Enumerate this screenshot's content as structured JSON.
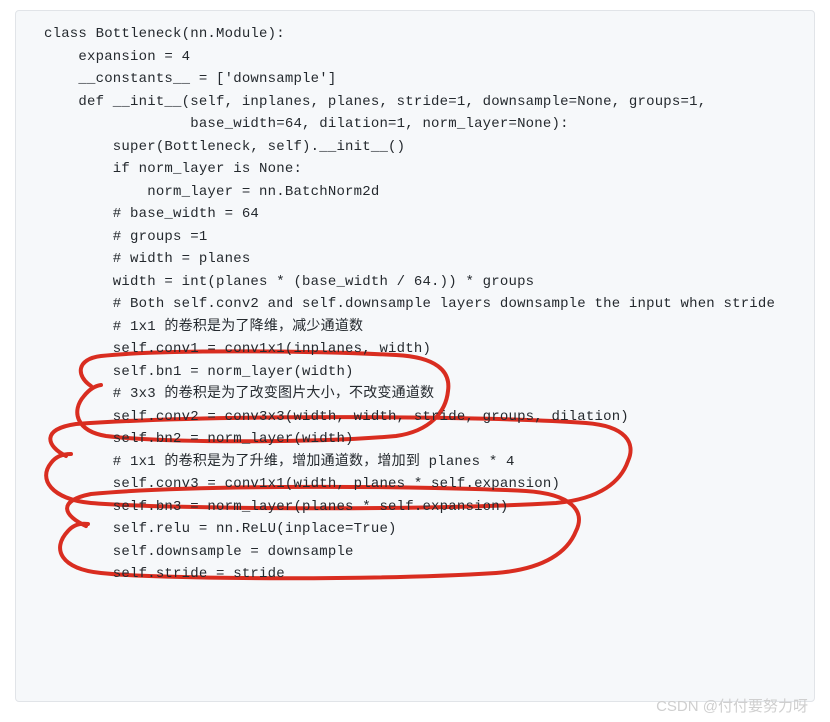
{
  "code": {
    "lines": [
      "class Bottleneck(nn.Module):",
      "    expansion = 4",
      "    __constants__ = ['downsample']",
      "",
      "    def __init__(self, inplanes, planes, stride=1, downsample=None, groups=1,",
      "                 base_width=64, dilation=1, norm_layer=None):",
      "        super(Bottleneck, self).__init__()",
      "        if norm_layer is None:",
      "            norm_layer = nn.BatchNorm2d",
      "",
      "        # base_width = 64",
      "        # groups =1",
      "        # width = planes",
      "        width = int(planes * (base_width / 64.)) * groups",
      "        # Both self.conv2 and self.downsample layers downsample the input when stride",
      "        # 1x1 的卷积是为了降维，减少通道数",
      "        self.conv1 = conv1x1(inplanes, width)",
      "        self.bn1 = norm_layer(width)",
      "        # 3x3 的卷积是为了改变图片大小，不改变通道数",
      "        self.conv2 = conv3x3(width, width, stride, groups, dilation)",
      "        self.bn2 = norm_layer(width)",
      "        # 1x1 的卷积是为了升维，增加通道数，增加到 planes * 4",
      "        self.conv3 = conv1x1(width, planes * self.expansion)",
      "        self.bn3 = norm_layer(planes * self.expansion)",
      "        self.relu = nn.ReLU(inplace=True)",
      "        self.downsample = downsample",
      "        self.stride = stride"
    ]
  },
  "watermark": "CSDN @付付要努力呀",
  "annotations": {
    "color": "#d92d20",
    "stroke_width": 4
  }
}
